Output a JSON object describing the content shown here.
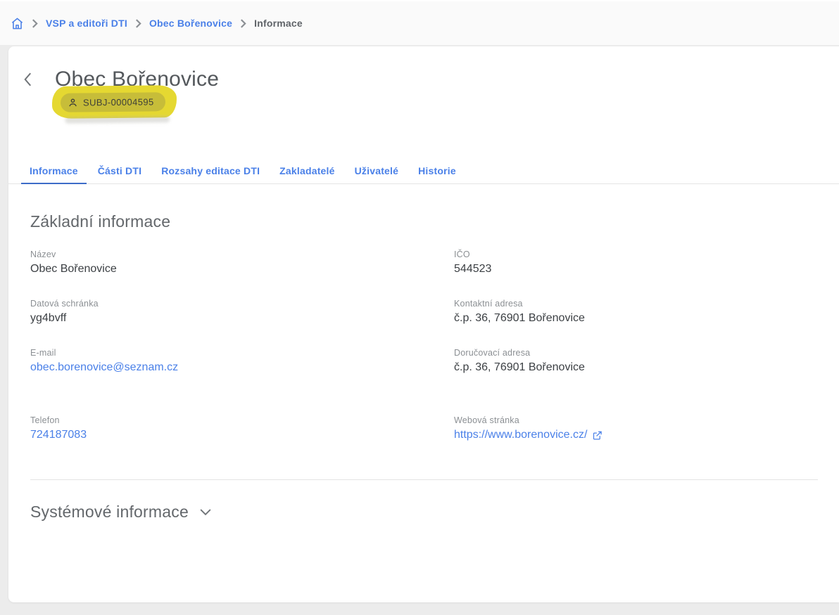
{
  "breadcrumb": {
    "items": [
      {
        "label": "VSP a editoři DTI",
        "current": false
      },
      {
        "label": "Obec Bořenovice",
        "current": false
      },
      {
        "label": "Informace",
        "current": true
      }
    ]
  },
  "header": {
    "title": "Obec Bořenovice",
    "subject_badge": {
      "id": "SUBJ-00004595",
      "icon": "person-icon",
      "highlight_color": "#e5d831"
    }
  },
  "tabs": {
    "items": [
      {
        "label": "Informace",
        "active": true
      },
      {
        "label": "Části DTI",
        "active": false
      },
      {
        "label": "Rozsahy editace DTI",
        "active": false
      },
      {
        "label": "Zakladatelé",
        "active": false
      },
      {
        "label": "Uživatelé",
        "active": false
      },
      {
        "label": "Historie",
        "active": false
      }
    ]
  },
  "sections": {
    "basic": {
      "title": "Základní informace",
      "left_fields": [
        {
          "label": "Název",
          "value": "Obec Bořenovice",
          "type": "text"
        },
        {
          "label": "Datová schránka",
          "value": "yg4bvff",
          "type": "text"
        },
        {
          "label": "E-mail",
          "value": "obec.borenovice@seznam.cz",
          "type": "link"
        },
        {
          "label": "Telefon",
          "value": "724187083",
          "type": "link"
        }
      ],
      "right_fields": [
        {
          "label": "IČO",
          "value": "544523",
          "type": "text"
        },
        {
          "label": "Kontaktní adresa",
          "value": "č.p. 36, 76901 Bořenovice",
          "type": "text"
        },
        {
          "label": "Doručovací adresa",
          "value": "č.p. 36, 76901 Bořenovice",
          "type": "text"
        },
        {
          "label": "Webová stránka",
          "value": "https://www.borenovice.cz/",
          "type": "external-link"
        }
      ]
    },
    "system": {
      "title": "Systémové informace",
      "collapsed": true
    }
  },
  "colors": {
    "accent_blue": "#4a80e8",
    "tab_underline": "#3d6cc8",
    "highlight_yellow": "#e5d831",
    "page_background": "#ececec",
    "topbar_background": "#fafafa"
  }
}
